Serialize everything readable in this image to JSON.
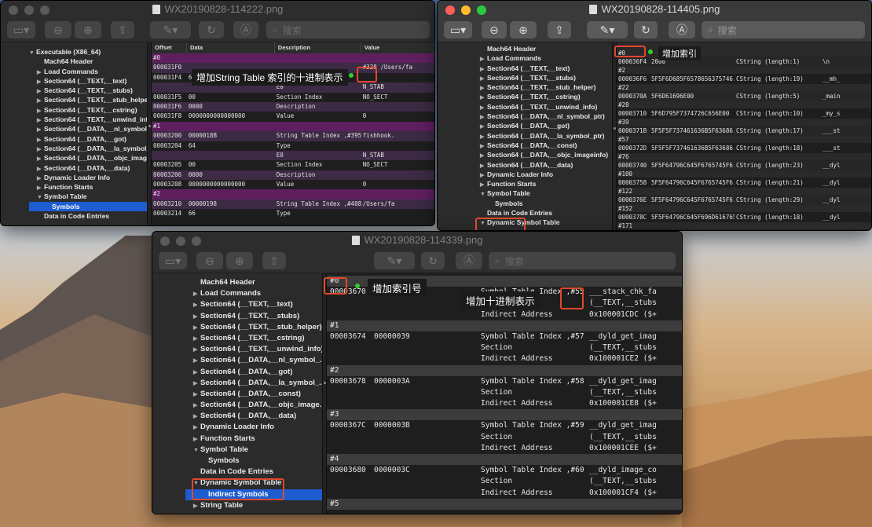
{
  "win1": {
    "title": "WX20190828-114222.png",
    "search": "搜索",
    "sidebar": [
      {
        "tri": "▼",
        "label": "Executable (X86_64)",
        "indent": 0
      },
      {
        "tri": "",
        "label": "Mach64 Header",
        "indent": 1
      },
      {
        "tri": "▶",
        "label": "Load Commands",
        "indent": 1
      },
      {
        "tri": "▶",
        "label": "Section64 (__TEXT,__text)",
        "indent": 1
      },
      {
        "tri": "▶",
        "label": "Section64 (__TEXT,__stubs)",
        "indent": 1
      },
      {
        "tri": "▶",
        "label": "Section64 (__TEXT,__stub_helper)",
        "indent": 1
      },
      {
        "tri": "▶",
        "label": "Section64 (__TEXT,__cstring)",
        "indent": 1
      },
      {
        "tri": "▶",
        "label": "Section64 (__TEXT,__unwind_info)",
        "indent": 1
      },
      {
        "tri": "▶",
        "label": "Section64 (__DATA,__nl_symbol_ptr)",
        "indent": 1
      },
      {
        "tri": "▶",
        "label": "Section64 (__DATA,__got)",
        "indent": 1
      },
      {
        "tri": "▶",
        "label": "Section64 (__DATA,__la_symbol_ptr)",
        "indent": 1
      },
      {
        "tri": "▶",
        "label": "Section64 (__DATA,__objc_imageinfo)",
        "indent": 1
      },
      {
        "tri": "▶",
        "label": "Section64 (__DATA,__data)",
        "indent": 1
      },
      {
        "tri": "▶",
        "label": "Dynamic Loader Info",
        "indent": 1
      },
      {
        "tri": "▶",
        "label": "Function Starts",
        "indent": 1
      },
      {
        "tri": "▼",
        "label": "Symbol Table",
        "indent": 1
      },
      {
        "tri": "",
        "label": "Symbols",
        "indent": 2,
        "selected": true
      },
      {
        "tri": "",
        "label": "Data in Code Entries",
        "indent": 1
      }
    ],
    "columns": [
      "Offset",
      "Data",
      "Description",
      "Value"
    ],
    "rows": [
      {
        "type": "sep",
        "text": "#0"
      },
      {
        "type": "rc",
        "c": [
          "000031F0",
          "",
          "",
          "#328 /Users/fa"
        ]
      },
      {
        "type": "",
        "c": [
          "000031F4",
          "64",
          "Type",
          ""
        ]
      },
      {
        "type": "rc",
        "c": [
          "",
          "",
          "E0",
          "N_STAB"
        ]
      },
      {
        "type": "",
        "c": [
          "000031F5",
          "00",
          "Section Index",
          "NO_SECT"
        ]
      },
      {
        "type": "rc",
        "c": [
          "000031F6",
          "0000",
          "Description",
          ""
        ]
      },
      {
        "type": "",
        "c": [
          "000031F8",
          "0000000000000000",
          "Value",
          "0"
        ]
      },
      {
        "type": "sep",
        "text": "#1"
      },
      {
        "type": "rc",
        "c": [
          "00003200",
          "0000018B",
          "String Table Index ,#395",
          "fishhook."
        ]
      },
      {
        "type": "",
        "c": [
          "00003204",
          "64",
          "Type",
          ""
        ]
      },
      {
        "type": "rc",
        "c": [
          "",
          "",
          "E0",
          "N_STAB"
        ]
      },
      {
        "type": "",
        "c": [
          "00003205",
          "00",
          "Section Index",
          "NO_SECT"
        ]
      },
      {
        "type": "rc",
        "c": [
          "00003206",
          "0000",
          "Description",
          ""
        ]
      },
      {
        "type": "",
        "c": [
          "00003208",
          "0000000000000000",
          "Value",
          "0"
        ]
      },
      {
        "type": "sep",
        "text": "#2"
      },
      {
        "type": "rc",
        "c": [
          "00003210",
          "00000198",
          "String Table Index ,#408",
          "/Users/fa"
        ]
      },
      {
        "type": "",
        "c": [
          "00003214",
          "66",
          "Type",
          ""
        ]
      }
    ],
    "callout": "增加String Table 索引的十进制表示",
    "boxed": "#328"
  },
  "win2": {
    "title": "WX20190828-114405.png",
    "search": "搜索",
    "sidebar": [
      {
        "tri": "",
        "label": "Mach64 Header",
        "indent": 1
      },
      {
        "tri": "▶",
        "label": "Load Commands",
        "indent": 1
      },
      {
        "tri": "▶",
        "label": "Section64 (__TEXT,__text)",
        "indent": 1
      },
      {
        "tri": "▶",
        "label": "Section64 (__TEXT,__stubs)",
        "indent": 1
      },
      {
        "tri": "▶",
        "label": "Section64 (__TEXT,__stub_helper)",
        "indent": 1
      },
      {
        "tri": "▶",
        "label": "Section64 (__TEXT,__cstring)",
        "indent": 1
      },
      {
        "tri": "▶",
        "label": "Section64 (__TEXT,__unwind_info)",
        "indent": 1
      },
      {
        "tri": "▶",
        "label": "Section64 (__DATA,__nl_symbol_ptr)",
        "indent": 1
      },
      {
        "tri": "▶",
        "label": "Section64 (__DATA,__got)",
        "indent": 1
      },
      {
        "tri": "▶",
        "label": "Section64 (__DATA,__la_symbol_ptr)",
        "indent": 1
      },
      {
        "tri": "▶",
        "label": "Section64 (__DATA,__const)",
        "indent": 1
      },
      {
        "tri": "▶",
        "label": "Section64 (__DATA,__objc_imageinfo)",
        "indent": 1
      },
      {
        "tri": "▶",
        "label": "Section64 (__DATA,__data)",
        "indent": 1
      },
      {
        "tri": "▶",
        "label": "Dynamic Loader Info",
        "indent": 1
      },
      {
        "tri": "▶",
        "label": "Function Starts",
        "indent": 1
      },
      {
        "tri": "▼",
        "label": "Symbol Table",
        "indent": 1
      },
      {
        "tri": "",
        "label": "Symbols",
        "indent": 2
      },
      {
        "tri": "",
        "label": "Data in Code Entries",
        "indent": 1
      },
      {
        "tri": "▼",
        "label": "Dynamic Symbol Table",
        "indent": 1
      },
      {
        "tri": "",
        "label": "Indirect Symbols",
        "indent": 2
      },
      {
        "tri": "▼",
        "label": "String Table",
        "indent": 0
      },
      {
        "tri": "",
        "label": "Strings Parse",
        "indent": 2,
        "selected": true
      }
    ],
    "rows": [
      {
        "idx": "#0",
        "off": "000036F4",
        "data": "2000",
        "desc": "CString (length:1)",
        "val": "\\n"
      },
      {
        "idx": "#2",
        "off": "000036F6",
        "data": "5F5F6D685F6578656375746...",
        "desc": "CString (length:19)",
        "val": "__mh_"
      },
      {
        "idx": "#22",
        "off": "0000370A",
        "data": "5F6D61696E00",
        "desc": "CString (length:5)",
        "val": "_main"
      },
      {
        "idx": "#28",
        "off": "00003710",
        "data": "5F6D795F7374726C656E00",
        "desc": "CString (length:10)",
        "val": "_my_s"
      },
      {
        "idx": "#39",
        "off": "0000371B",
        "data": "5F5F5F737461636B5F63686...",
        "desc": "CString (length:17)",
        "val": "___st"
      },
      {
        "idx": "#57",
        "off": "0000372D",
        "data": "5F5F5F737461636B5F63686...",
        "desc": "CString (length:18)",
        "val": "___st"
      },
      {
        "idx": "#76",
        "off": "00003740",
        "data": "5F5F64796C645F6765745F6...",
        "desc": "CString (length:23)",
        "val": "__dyl"
      },
      {
        "idx": "#100",
        "off": "00003758",
        "data": "5F5F64796C645F6765745F6...",
        "desc": "CString (length:21)",
        "val": "__dyl"
      },
      {
        "idx": "#122",
        "off": "0000376E",
        "data": "5F5F64796C645F6765745F6...",
        "desc": "CString (length:29)",
        "val": "__dyl"
      },
      {
        "idx": "#152",
        "off": "0000378C",
        "data": "5F5F64796C645F696D616765...",
        "desc": "CString (length:18)",
        "val": "__dyl"
      },
      {
        "idx": "#171",
        "off": "",
        "data": "",
        "desc": "",
        "val": ""
      }
    ],
    "callout": "增加索引",
    "boxed": "#0"
  },
  "win3": {
    "title": "WX20190828-114339.png",
    "search": "搜索",
    "sidebar": [
      {
        "tri": "",
        "label": "Mach64 Header",
        "indent": 1
      },
      {
        "tri": "▶",
        "label": "Load Commands",
        "indent": 1
      },
      {
        "tri": "▶",
        "label": "Section64 (__TEXT,__text)",
        "indent": 1
      },
      {
        "tri": "▶",
        "label": "Section64 (__TEXT,__stubs)",
        "indent": 1
      },
      {
        "tri": "▶",
        "label": "Section64 (__TEXT,__stub_helper)",
        "indent": 1
      },
      {
        "tri": "▶",
        "label": "Section64 (__TEXT,__cstring)",
        "indent": 1
      },
      {
        "tri": "▶",
        "label": "Section64 (__TEXT,__unwind_info)",
        "indent": 1
      },
      {
        "tri": "▶",
        "label": "Section64 (__DATA,__nl_symbol_...",
        "indent": 1
      },
      {
        "tri": "▶",
        "label": "Section64 (__DATA,__got)",
        "indent": 1
      },
      {
        "tri": "▶",
        "label": "Section64 (__DATA,__la_symbol_...",
        "indent": 1
      },
      {
        "tri": "▶",
        "label": "Section64 (__DATA,__const)",
        "indent": 1
      },
      {
        "tri": "▶",
        "label": "Section64 (__DATA,__objc_image...",
        "indent": 1
      },
      {
        "tri": "▶",
        "label": "Section64 (__DATA,__data)",
        "indent": 1
      },
      {
        "tri": "▶",
        "label": "Dynamic Loader Info",
        "indent": 1
      },
      {
        "tri": "▶",
        "label": "Function Starts",
        "indent": 1
      },
      {
        "tri": "▼",
        "label": "Symbol Table",
        "indent": 1
      },
      {
        "tri": "",
        "label": "Symbols",
        "indent": 2
      },
      {
        "tri": "",
        "label": "Data in Code Entries",
        "indent": 1
      },
      {
        "tri": "▼",
        "label": "Dynamic Symbol Table",
        "indent": 1
      },
      {
        "tri": "",
        "label": "Indirect Symbols",
        "indent": 2,
        "selected": true
      },
      {
        "tri": "▶",
        "label": "String Table",
        "indent": 1
      }
    ],
    "groups": [
      {
        "idx": "#0",
        "off": "00003670",
        "data": "00000037",
        "desc": "Symbol Table Index ,#55",
        "val": "___stack_chk_fa",
        "sec": "(__TEXT,__stubs",
        "ind": "0x100001CDC ($+"
      },
      {
        "idx": "#1",
        "off": "00003674",
        "data": "00000039",
        "desc": "Symbol Table Index ,#57",
        "val": "__dyld_get_imag",
        "sec": "(__TEXT,__stubs",
        "ind": "0x100001CE2 ($+"
      },
      {
        "idx": "#2",
        "off": "00003678",
        "data": "0000003A",
        "desc": "Symbol Table Index ,#58",
        "val": "__dyld_get_imag",
        "sec": "(__TEXT,__stubs",
        "ind": "0x100001CE8 ($+"
      },
      {
        "idx": "#3",
        "off": "0000367C",
        "data": "0000003B",
        "desc": "Symbol Table Index ,#59",
        "val": "__dyld_get_imag",
        "sec": "(__TEXT,__stubs",
        "ind": "0x100001CEE ($+"
      },
      {
        "idx": "#4",
        "off": "00003680",
        "data": "0000003C",
        "desc": "Symbol Table Index ,#60",
        "val": "__dyld_image_co",
        "sec": "(__TEXT,__stubs",
        "ind": "0x100001CF4 ($+"
      },
      {
        "idx": "#5"
      }
    ],
    "lbl_section": "Section",
    "lbl_indirect": "Indirect Address",
    "callout1": "增加索引号",
    "callout2": "增加十进制表示",
    "boxed1": "#0",
    "boxed2": "#55"
  }
}
